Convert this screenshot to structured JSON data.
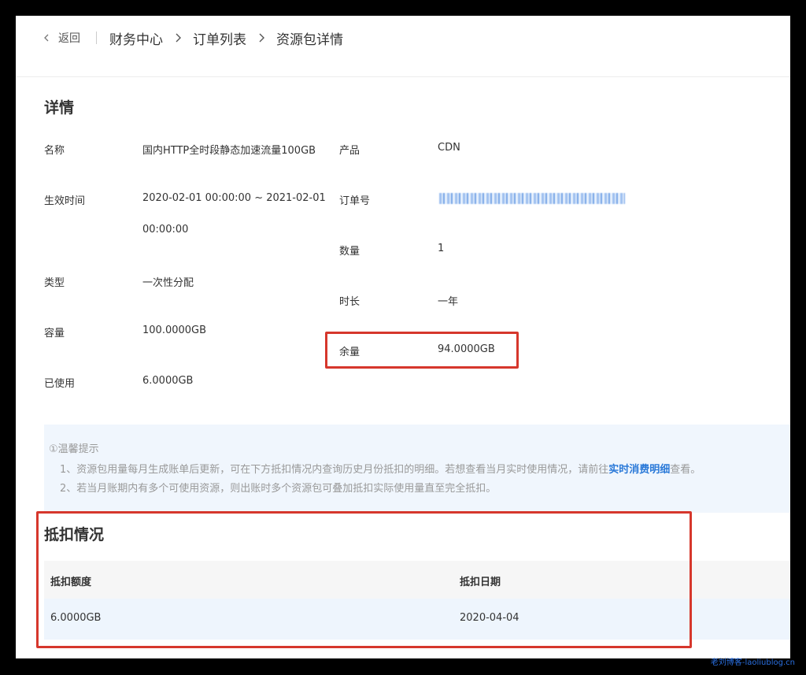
{
  "header": {
    "back_label": "返回",
    "breadcrumbs": [
      "财务中心",
      "订单列表",
      "资源包详情"
    ]
  },
  "details": {
    "title": "详情",
    "name_label": "名称",
    "name_value": "国内HTTP全时段静态加速流量100GB",
    "product_label": "产品",
    "product_value": "CDN",
    "effective_label": "生效时间",
    "effective_value_line1": "2020-02-01 00:00:00 ~ 2021-02-01",
    "effective_value_line2": "00:00:00",
    "order_label": "订单号",
    "quantity_label": "数量",
    "quantity_value": "1",
    "type_label": "类型",
    "type_value": "一次性分配",
    "duration_label": "时长",
    "duration_value": "一年",
    "capacity_label": "容量",
    "capacity_value": "100.0000GB",
    "remaining_label": "余量",
    "remaining_value": "94.0000GB",
    "used_label": "已使用",
    "used_value": "6.0000GB"
  },
  "tip": {
    "title": "①温馨提示",
    "line1_prefix": "1、资源包用量每月生成账单后更新，可在下方抵扣情况内查询历史月份抵扣的明细。若想查看当月实时使用情况，请前往",
    "line1_link": "实时消费明细",
    "line1_suffix": "查看。",
    "line2": "2、若当月账期内有多个可使用资源，则出账时多个资源包可叠加抵扣实际使用量直至完全抵扣。"
  },
  "deduction": {
    "title": "抵扣情况",
    "columns": [
      "抵扣额度",
      "抵扣日期"
    ],
    "rows": [
      {
        "amount": "6.0000GB",
        "date": "2020-04-04"
      }
    ]
  },
  "watermark": "老刘博客-laoliublog.cn",
  "colors": {
    "highlight": "#d6372c",
    "link": "#2a79d8",
    "tip_bg": "#f0f6fd"
  }
}
